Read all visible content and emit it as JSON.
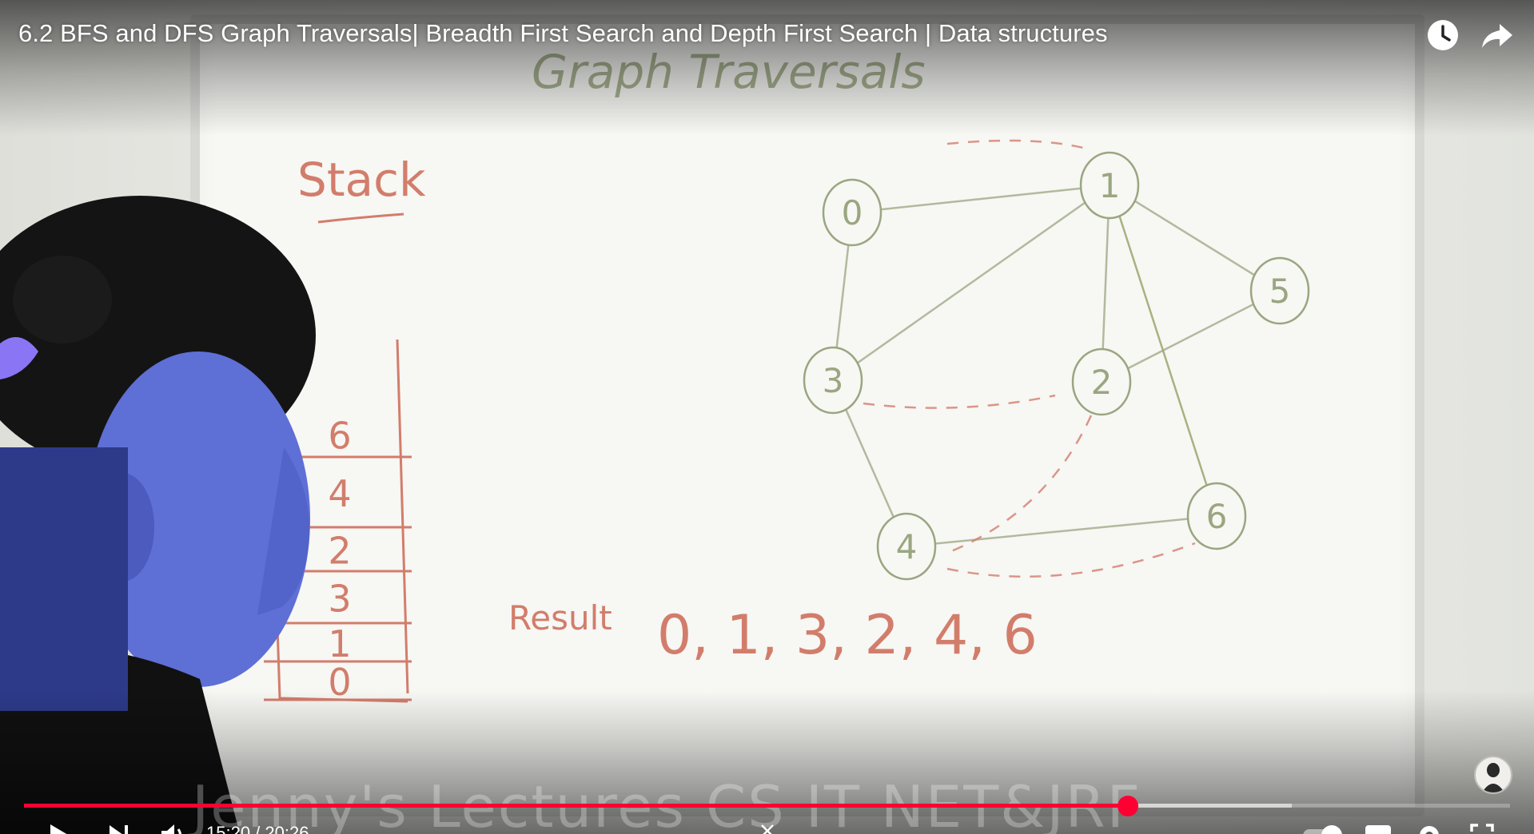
{
  "video": {
    "title": "6.2 BFS and DFS Graph Traversals| Breadth First Search and Depth First Search | Data structures",
    "time_display": "15:20 / 20:26",
    "progress_fraction": 0.743,
    "buffered_fraction": 0.853,
    "watermark": "Jenny's Lectures CS IT NET&JRF"
  },
  "top_controls": {
    "watch_later_icon": "clock-icon",
    "share_icon": "share-arrow-icon"
  },
  "bottom_controls": {
    "play_icon": "play-icon",
    "next_icon": "next-icon",
    "volume_icon": "volume-icon",
    "autoplay_icon": "autoplay-toggle-icon",
    "subtitles_icon": "subtitles-icon",
    "settings_icon": "gear-icon",
    "fullscreen_icon": "fullscreen-icon"
  },
  "whiteboard": {
    "heading": "Graph Traversals",
    "stack_label": "Stack",
    "stack_items": [
      "6",
      "4",
      "2",
      "3",
      "1",
      "0"
    ],
    "result_label": "Result",
    "result_values": "0, 1, 3, 2, 4, 6",
    "nodes": [
      "0",
      "1",
      "5",
      "3",
      "2",
      "4",
      "6"
    ]
  },
  "colors": {
    "progress": "#ff0033",
    "marker_red": "#d27d6b",
    "marker_green": "#9aa680"
  }
}
